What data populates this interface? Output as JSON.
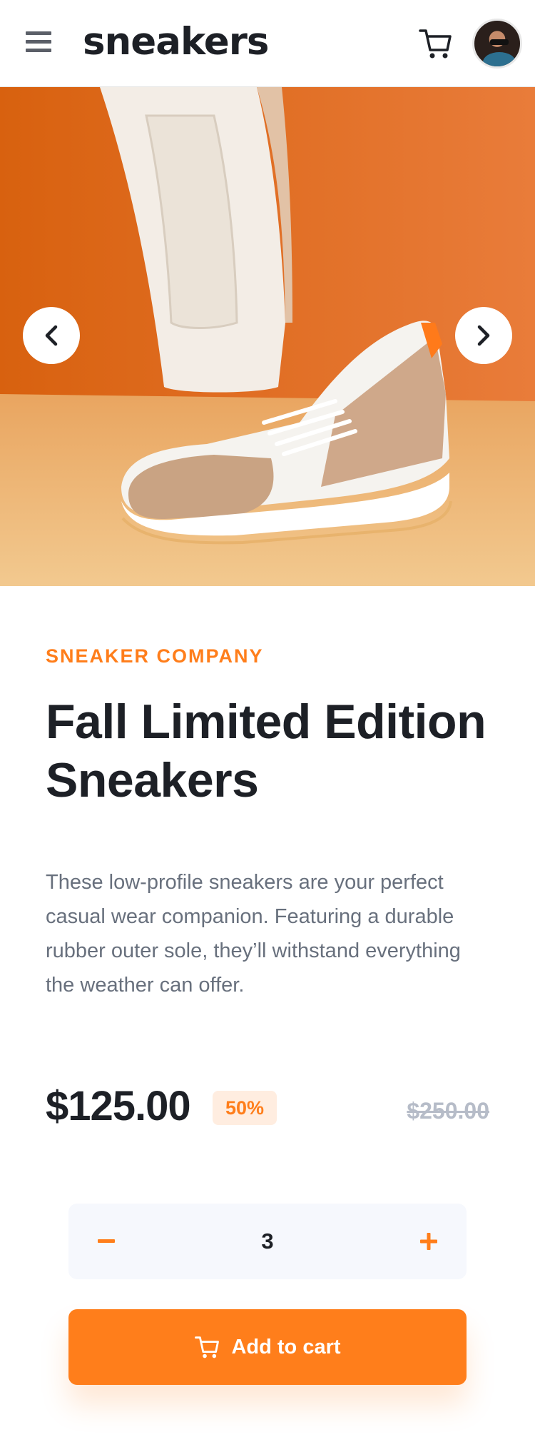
{
  "header": {
    "logo": "sneakers",
    "menu_icon": "hamburger-menu-icon",
    "cart_icon": "shopping-cart-icon",
    "avatar_icon": "user-avatar"
  },
  "gallery": {
    "prev_icon": "chevron-left-icon",
    "next_icon": "chevron-right-icon"
  },
  "product": {
    "company": "SNEAKER COMPANY",
    "title": "Fall Limited Edition Sneakers",
    "description": "These low-profile sneakers are your perfect casual wear companion. Featuring a durable rubber outer sole, they’ll withstand everything the weather can offer.",
    "price": "$125.00",
    "discount": "50%",
    "original_price": "$250.00"
  },
  "quantity": {
    "value": "3",
    "minus_icon": "minus-icon",
    "plus_icon": "plus-icon"
  },
  "cta": {
    "label": "Add to cart",
    "icon": "shopping-cart-icon"
  },
  "colors": {
    "accent": "#ff7e1b",
    "accent_pale": "#ffede0",
    "text_dark": "#1d2026",
    "text_gray": "#68707d",
    "text_light": "#b6bcc8",
    "panel_bg": "#f6f8fd"
  }
}
